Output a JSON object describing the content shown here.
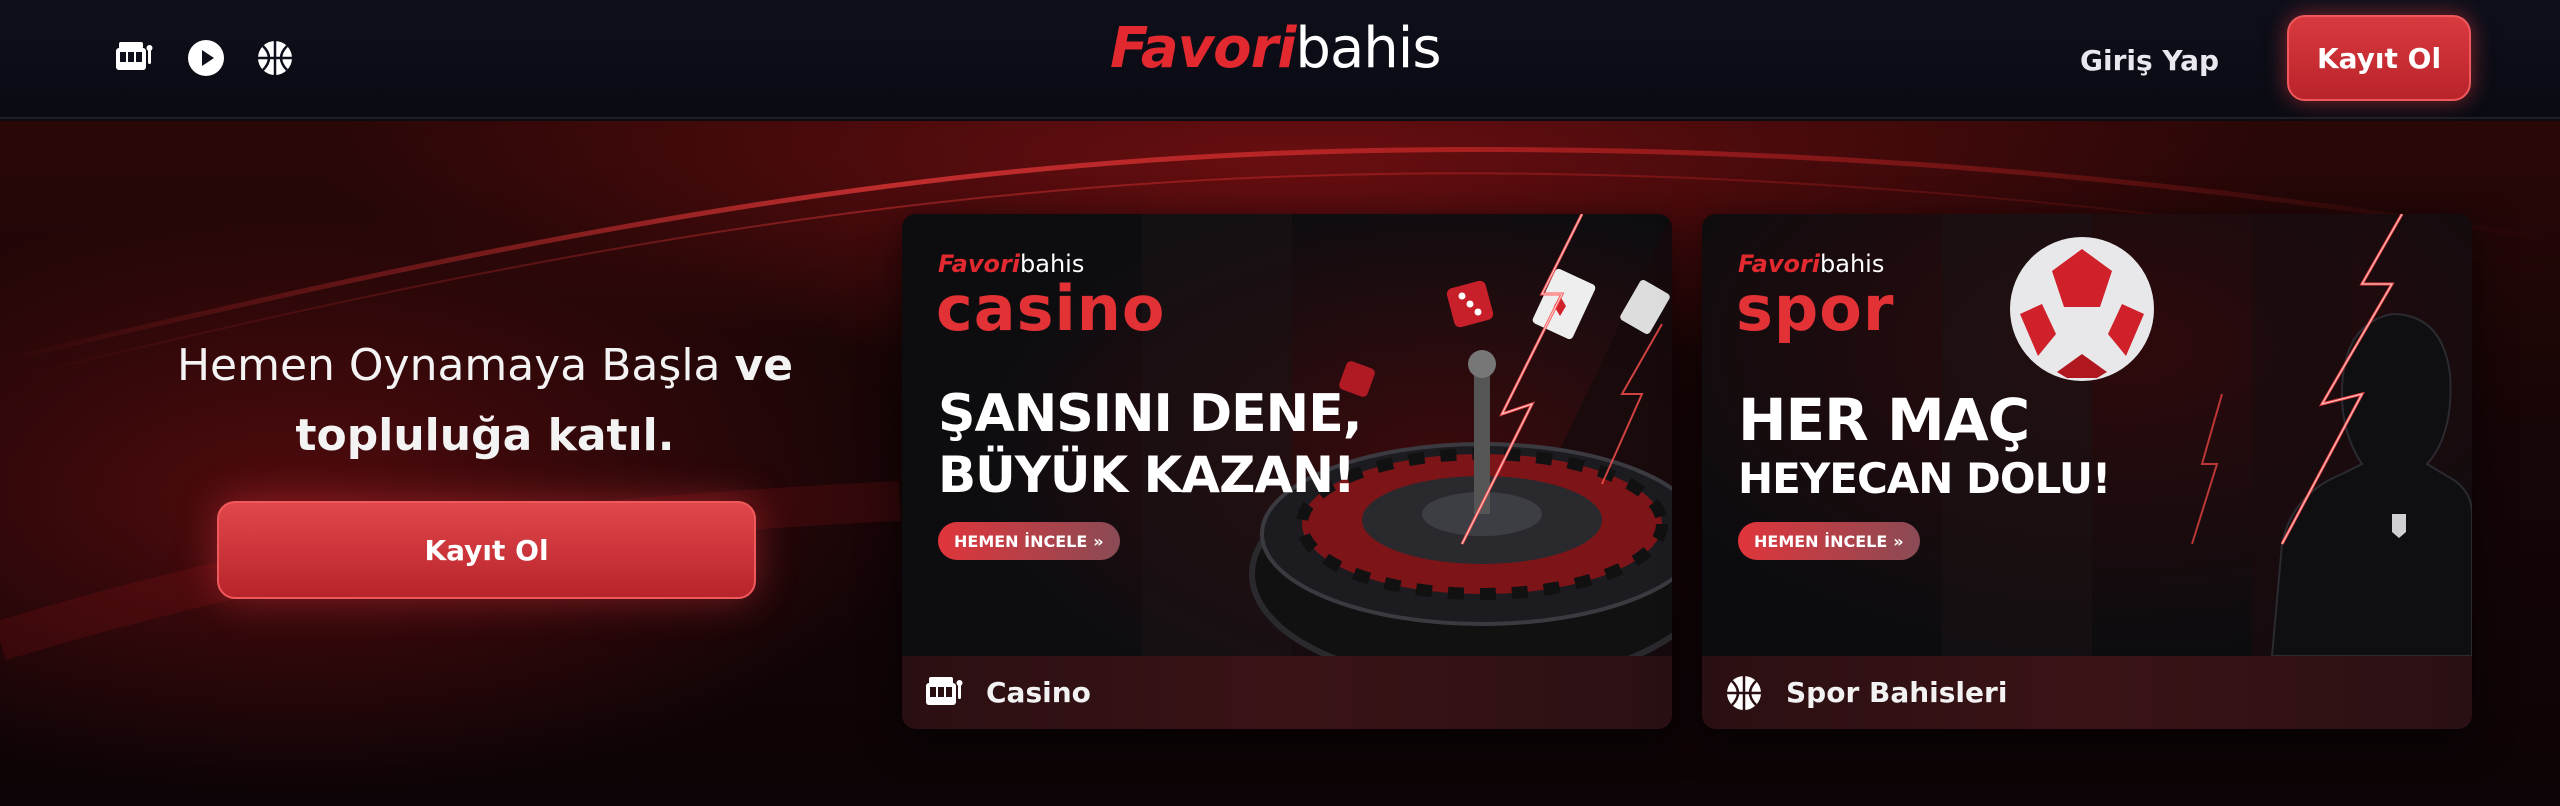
{
  "header": {
    "icons": [
      "slot-machine-icon",
      "play-icon",
      "basketball-icon"
    ],
    "logo_part1": "Favori",
    "logo_part2": "bahis",
    "login_label": "Giriş Yap",
    "register_label": "Kayıt Ol"
  },
  "hero": {
    "title_light": "Hemen Oynamaya Başla",
    "title_bold_1": "ve",
    "title_bold_2": "topluluğa katıl.",
    "register_label": "Kayıt Ol"
  },
  "cards": [
    {
      "banner_logo_part1": "Favori",
      "banner_logo_part2": "bahis",
      "banner_word": "casino",
      "headline_1": "ŞANSINI DENE,",
      "headline_2": "BÜYÜK KAZAN!",
      "cta": "HEMEN İNCELE",
      "footer_icon": "slot-machine-icon",
      "footer_label": "Casino"
    },
    {
      "banner_logo_part1": "Favori",
      "banner_logo_part2": "bahis",
      "banner_word": "spor",
      "headline_1": "HER MAÇ",
      "headline_2": "HEYECAN DOLU!",
      "cta": "HEMEN İNCELE",
      "footer_icon": "basketball-icon",
      "footer_label": "Spor Bahisleri"
    }
  ],
  "colors": {
    "brand_red": "#e1292f",
    "header_bg": "#0d0f1a",
    "hero_bg": "#1a0607"
  }
}
